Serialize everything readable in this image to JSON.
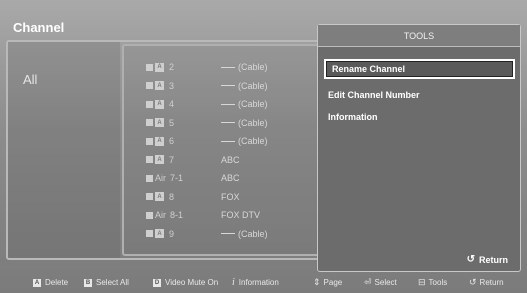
{
  "window": {
    "title": "Channel"
  },
  "left_panel": {
    "category": "All"
  },
  "channels": [
    {
      "source": "antenna",
      "number": "2",
      "name": "(Cable)",
      "has_dash": true
    },
    {
      "source": "antenna",
      "number": "3",
      "name": "(Cable)",
      "has_dash": true
    },
    {
      "source": "antenna",
      "number": "4",
      "name": "(Cable)",
      "has_dash": true
    },
    {
      "source": "antenna",
      "number": "5",
      "name": "(Cable)",
      "has_dash": true
    },
    {
      "source": "antenna",
      "number": "6",
      "name": "(Cable)",
      "has_dash": true
    },
    {
      "source": "antenna",
      "number": "7",
      "name": "ABC",
      "has_dash": false
    },
    {
      "source": "air",
      "source_label": "Air",
      "number": "7-1",
      "name": "ABC",
      "has_dash": false
    },
    {
      "source": "antenna",
      "number": "8",
      "name": "FOX",
      "has_dash": false
    },
    {
      "source": "air",
      "source_label": "Air",
      "number": "8-1",
      "name": "FOX DTV",
      "has_dash": false
    },
    {
      "source": "antenna",
      "number": "9",
      "name": "(Cable)",
      "has_dash": true
    }
  ],
  "tools": {
    "title": "TOOLS",
    "items": [
      "Rename Channel",
      "Edit Channel Number",
      "Information"
    ],
    "selected": "Rename Channel",
    "return_label": "Return",
    "return_icon": "return-arrow-icon"
  },
  "bottom_bar": {
    "delete": {
      "key": "A",
      "label": "Delete"
    },
    "select_all": {
      "key": "B",
      "label": "Select All"
    },
    "video_mute": {
      "key": "D",
      "label": "Video Mute On"
    },
    "information": {
      "key": "i",
      "label": "Information"
    },
    "page": {
      "icon": "up-down-arrow-icon",
      "label": "Page"
    },
    "select": {
      "icon": "enter-icon",
      "label": "Select"
    },
    "tools": {
      "icon": "tools-icon",
      "label": "Tools"
    },
    "return": {
      "icon": "return-arrow-icon",
      "label": "Return"
    }
  },
  "colors": {
    "background": "#8c8c8c",
    "panel": "#6c6c6c",
    "text": "#ffffff",
    "highlight_border": "#ffffff"
  }
}
